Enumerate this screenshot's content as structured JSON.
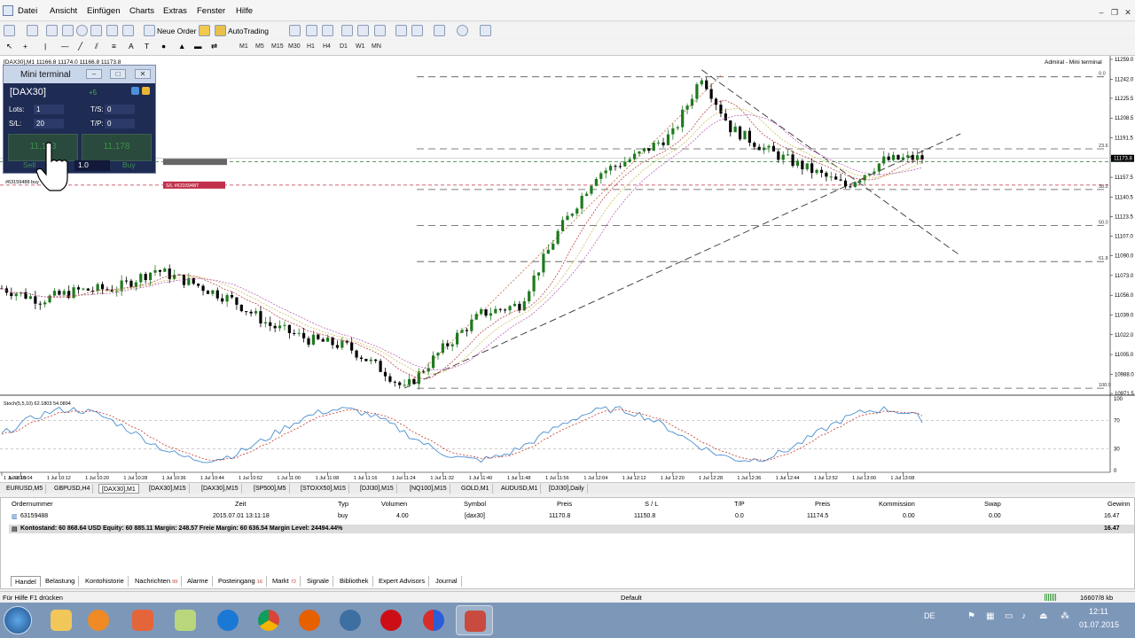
{
  "menu": {
    "items": [
      "Datei",
      "Ansicht",
      "Einfügen",
      "Charts",
      "Extras",
      "Fenster",
      "Hilfe"
    ]
  },
  "toolbar": {
    "new_order": "Neue Order",
    "autotrading": "AutoTrading",
    "timeframes": [
      "M1",
      "M5",
      "M15",
      "M30",
      "H1",
      "H4",
      "D1",
      "W1",
      "MN"
    ]
  },
  "chart": {
    "header": "[DAX30],M1  11166.8 11174.0 11166.8 11173.8",
    "top_right_label": "Admiral - Mini terminal",
    "price_ticks": [
      "11259.0",
      "11242.0",
      "11225.5",
      "11208.5",
      "11191.5",
      "11174.5",
      "11157.5",
      "11140.5",
      "11123.5",
      "11107.0",
      "11090.0",
      "11073.0",
      "11056.0",
      "11039.0",
      "11022.0",
      "11005.0",
      "10988.0",
      "10971.5"
    ],
    "current_price": "11173.8",
    "fib_labels": [
      "0.0",
      "23.6",
      "38.2",
      "50.0",
      "61.8",
      "100.0"
    ],
    "order_line_label": "#63159488  buy",
    "sl_label": "S/L #63159487",
    "stoch_header": "Stoch(5,5,10) 62.1803 54.0894",
    "stoch_ticks": [
      "100",
      "70",
      "30",
      "0"
    ],
    "time_ticks": [
      "1 Jul 2015",
      "1 Jul 10:04",
      "1 Jul 10:12",
      "1 Jul 10:20",
      "1 Jul 10:28",
      "1 Jul 10:36",
      "1 Jul 10:44",
      "1 Jul 10:52",
      "1 Jul 11:00",
      "1 Jul 11:08",
      "1 Jul 11:16",
      "1 Jul 11:24",
      "1 Jul 11:32",
      "1 Jul 11:40",
      "1 Jul 11:48",
      "1 Jul 11:56",
      "1 Jul 12:04",
      "1 Jul 12:12",
      "1 Jul 12:20",
      "1 Jul 12:28",
      "1 Jul 12:36",
      "1 Jul 12:44",
      "1 Jul 12:52",
      "1 Jul 13:00",
      "1 Jul 13:08"
    ]
  },
  "mini_terminal": {
    "title": "Mini terminal",
    "symbol": "[DAX30]",
    "spread": "+5",
    "lots_label": "Lots:",
    "lots_value": "1",
    "sl_label": "S/L:",
    "sl_value": "20",
    "ts_label": "T/S:",
    "ts_value": "0",
    "tp_label": "T/P:",
    "tp_value": "0",
    "sell_price": "11,173",
    "buy_price": "11,178",
    "sell_label": "Sell",
    "buy_label": "Buy",
    "volume": "1.0"
  },
  "symbol_tabs": [
    "EURUSD,M5",
    "GBPUSD,H4",
    "[DAX30],M1",
    "[DAX30],M15",
    "[DAX30],M15",
    "[SP500],M5",
    "[STOXX50],M15",
    "[DJI30],M15",
    "[NQ100],M15",
    "GOLD,M1",
    "AUDUSD,M1",
    "[DJI30],Daily"
  ],
  "terminal": {
    "headers": [
      "Ordernummer",
      "Zeit",
      "Typ",
      "Volumen",
      "Symbol",
      "Preis",
      "S / L",
      "T/P",
      "Preis",
      "Kommission",
      "Swap",
      "Gewinn"
    ],
    "row": [
      "63159488",
      "2015.07.01 13:11:18",
      "buy",
      "4.00",
      "[dax30]",
      "11170.8",
      "11150.8",
      "0.0",
      "11174.5",
      "0.00",
      "0.00",
      "16.47"
    ],
    "summary": "Kontostand: 60 868.64 USD  Equity: 60 885.11  Margin: 248.57  Freie Margin: 60 636.54  Margin Level: 24494.44%",
    "summary_profit": "16.47",
    "tabs": [
      {
        "label": "Handel",
        "count": ""
      },
      {
        "label": "Belastung",
        "count": ""
      },
      {
        "label": "Kontohistorie",
        "count": ""
      },
      {
        "label": "Nachrichten",
        "count": "99"
      },
      {
        "label": "Alarme",
        "count": ""
      },
      {
        "label": "Posteingang",
        "count": "16"
      },
      {
        "label": "Markt",
        "count": "72"
      },
      {
        "label": "Signale",
        "count": ""
      },
      {
        "label": "Bibliothek",
        "count": ""
      },
      {
        "label": "Expert Advisors",
        "count": ""
      },
      {
        "label": "Journal",
        "count": ""
      }
    ]
  },
  "status": {
    "help": "Für Hilfe F1 drücken",
    "profile": "Default",
    "traffic": "16607/8 kb"
  },
  "taskbar": {
    "lang": "DE",
    "time": "12:11",
    "date": "01.07.2015"
  },
  "chart_data": {
    "type": "candlestick",
    "symbol": "[DAX30]",
    "timeframe": "M1",
    "ohlc_header": {
      "open": 11166.8,
      "high": 11174.0,
      "low": 11166.8,
      "close": 11173.8
    },
    "y_range": [
      10971.5,
      11259.0
    ],
    "approx_close_path": [
      {
        "t": "1 Jul 10:00",
        "price": 11062
      },
      {
        "t": "1 Jul 10:08",
        "price": 11052
      },
      {
        "t": "1 Jul 10:16",
        "price": 11060
      },
      {
        "t": "1 Jul 10:24",
        "price": 11062
      },
      {
        "t": "1 Jul 10:32",
        "price": 11078
      },
      {
        "t": "1 Jul 10:40",
        "price": 11066
      },
      {
        "t": "1 Jul 10:48",
        "price": 11052
      },
      {
        "t": "1 Jul 10:56",
        "price": 11030
      },
      {
        "t": "1 Jul 11:04",
        "price": 11018
      },
      {
        "t": "1 Jul 11:12",
        "price": 11012
      },
      {
        "t": "1 Jul 11:20",
        "price": 10990
      },
      {
        "t": "1 Jul 11:24",
        "price": 10975
      },
      {
        "t": "1 Jul 11:32",
        "price": 11010
      },
      {
        "t": "1 Jul 11:40",
        "price": 11040
      },
      {
        "t": "1 Jul 11:48",
        "price": 11048
      },
      {
        "t": "1 Jul 11:56",
        "price": 11110
      },
      {
        "t": "1 Jul 12:04",
        "price": 11160
      },
      {
        "t": "1 Jul 12:12",
        "price": 11175
      },
      {
        "t": "1 Jul 12:20",
        "price": 11195
      },
      {
        "t": "1 Jul 12:26",
        "price": 11245
      },
      {
        "t": "1 Jul 12:32",
        "price": 11200
      },
      {
        "t": "1 Jul 12:40",
        "price": 11180
      },
      {
        "t": "1 Jul 12:48",
        "price": 11165
      },
      {
        "t": "1 Jul 12:56",
        "price": 11150
      },
      {
        "t": "1 Jul 13:04",
        "price": 11172
      },
      {
        "t": "1 Jul 13:10",
        "price": 11174
      }
    ],
    "fibonacci_levels": [
      {
        "label": "0.0",
        "price": 11244
      },
      {
        "label": "23.6",
        "price": 11182
      },
      {
        "label": "38.2",
        "price": 11147
      },
      {
        "label": "50.0",
        "price": 11116
      },
      {
        "label": "61.8",
        "price": 11085
      },
      {
        "label": "100.0",
        "price": 10976
      }
    ],
    "stochastic": {
      "name": "Stoch(5,5,10)",
      "main": 62.1803,
      "signal": 54.0894,
      "levels": [
        70,
        30
      ],
      "range": [
        0,
        100
      ]
    }
  },
  "colors": {
    "bull_candle": "#1f7a1f",
    "bear_candle": "#000000",
    "taskbar": "#7d97b9",
    "mini_bg": "#1e2b53",
    "sl_tag": "#c0304a"
  }
}
